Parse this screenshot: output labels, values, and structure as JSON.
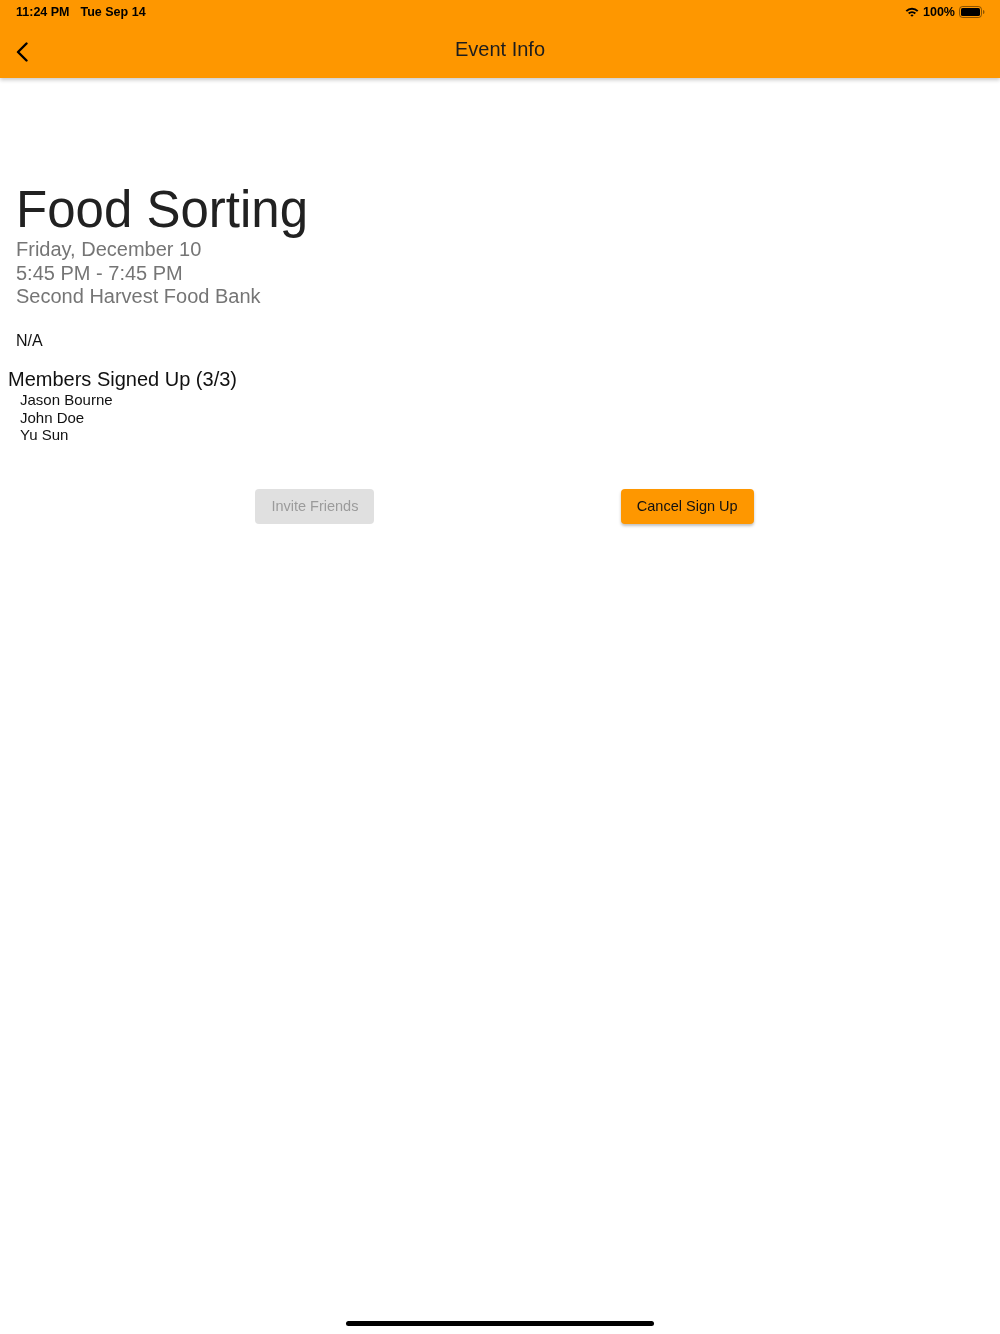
{
  "status_bar": {
    "time": "11:24 PM",
    "date": "Tue Sep 14",
    "battery": "100%"
  },
  "app_bar": {
    "title": "Event Info"
  },
  "event": {
    "title": "Food Sorting",
    "date": "Friday, December 10",
    "time": "5:45 PM - 7:45 PM",
    "location": "Second Harvest Food Bank",
    "description": "N/A"
  },
  "members": {
    "heading": "Members Signed Up (3/3)",
    "names": [
      "Jason Bourne",
      "John Doe",
      "Yu Sun"
    ]
  },
  "buttons": [
    {
      "label": "Invite Friends",
      "disabled": true
    },
    {
      "label": "Cancel Sign Up",
      "disabled": false
    }
  ]
}
